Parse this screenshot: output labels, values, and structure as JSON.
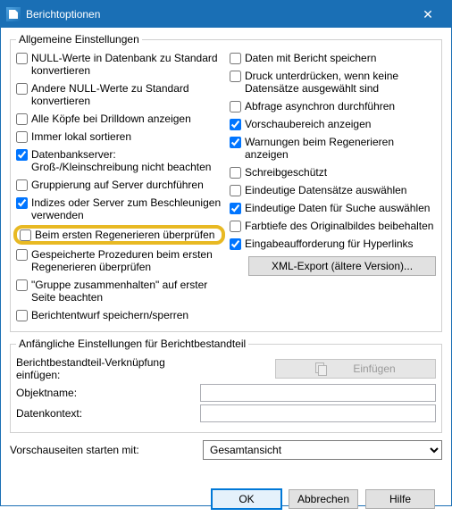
{
  "window": {
    "title": "Berichtoptionen",
    "close_glyph": "✕"
  },
  "group_general": {
    "legend": "Allgemeine Einstellungen",
    "left": [
      {
        "label": "NULL-Werte in Datenbank zu Standard konvertieren",
        "checked": false
      },
      {
        "label": "Andere NULL-Werte zu Standard konvertieren",
        "checked": false
      },
      {
        "label": "Alle Köpfe bei Drilldown anzeigen",
        "checked": false
      },
      {
        "label": "Immer lokal sortieren",
        "checked": false
      },
      {
        "label": "Datenbankserver: Groß-/Kleinschreibung nicht beachten",
        "checked": true
      },
      {
        "label": "Gruppierung auf Server durchführen",
        "checked": false
      },
      {
        "label": "Indizes oder Server zum Beschleunigen verwenden",
        "checked": true
      },
      {
        "label": "Beim ersten Regenerieren überprüfen",
        "checked": false,
        "highlight": true
      },
      {
        "label": "Gespeicherte Prozeduren beim ersten Regenerieren überprüfen",
        "checked": false
      },
      {
        "label": "\"Gruppe zusammenhalten\" auf erster Seite beachten",
        "checked": false
      },
      {
        "label": "Berichtentwurf speichern/sperren",
        "checked": false
      }
    ],
    "right": [
      {
        "label": "Daten mit Bericht speichern",
        "checked": false
      },
      {
        "label": "Druck unterdrücken, wenn keine Datensätze ausgewählt sind",
        "checked": false
      },
      {
        "label": "Abfrage asynchron durchführen",
        "checked": false
      },
      {
        "label": "Vorschaubereich anzeigen",
        "checked": true
      },
      {
        "label": "Warnungen beim Regenerieren anzeigen",
        "checked": true
      },
      {
        "label": "Schreibgeschützt",
        "checked": false
      },
      {
        "label": "Eindeutige Datensätze auswählen",
        "checked": false
      },
      {
        "label": "Eindeutige Daten für Suche auswählen",
        "checked": true
      },
      {
        "label": "Farbtiefe des Originalbildes beibehalten",
        "checked": false
      },
      {
        "label": "Eingabeaufforderung für Hyperlinks",
        "checked": true
      }
    ],
    "xml_export_label": "XML-Export (ältere Version)..."
  },
  "group_initial": {
    "legend": "Anfängliche Einstellungen für Berichtbestandteil",
    "link_label": "Berichtbestandteil-Verknüpfung einfügen:",
    "insert_label": "Einfügen",
    "objectname_label": "Objektname:",
    "datacontext_label": "Datenkontext:",
    "objectname_value": "",
    "datacontext_value": ""
  },
  "preview": {
    "label": "Vorschauseiten starten mit:",
    "selected": "Gesamtansicht"
  },
  "footer": {
    "ok": "OK",
    "cancel": "Abbrechen",
    "help": "Hilfe"
  }
}
